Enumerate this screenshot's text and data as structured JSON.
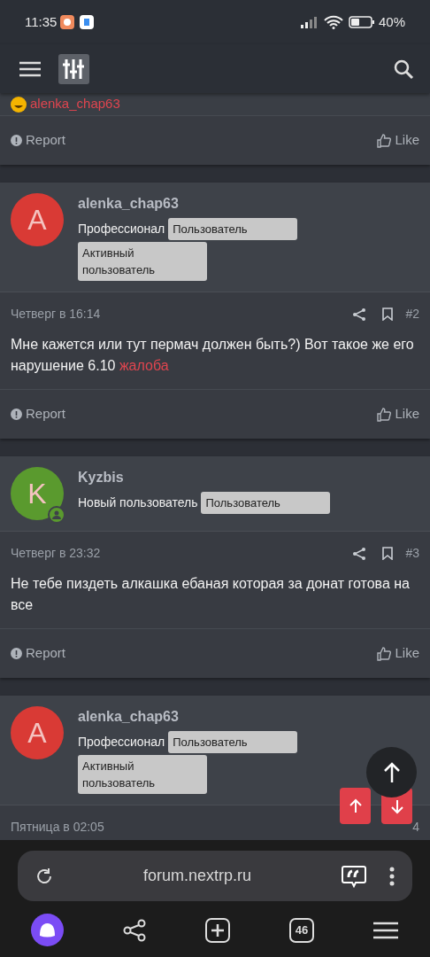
{
  "status_bar": {
    "time": "11:35",
    "battery": "40%"
  },
  "partial_post": {
    "reaction_user": "alenka_chap63",
    "report": "Report",
    "like": "Like"
  },
  "posts": [
    {
      "author": "alenka_chap63",
      "avatar_letter": "A",
      "color": "#d93a35",
      "online": false,
      "title": "Профессионал",
      "badges": [
        "Пользователь",
        "Активный пользователь"
      ],
      "date": "Четверг в 16:14",
      "actions_visible": true,
      "number": "#2",
      "message": "Мне кажется или тут пермач должен быть?) Вот такое же его нарушение 6.10",
      "link": "жалоба",
      "report": "Report",
      "like": "Like"
    },
    {
      "author": "Kyzbis",
      "avatar_letter": "K",
      "color": "#5a9a2e",
      "online": true,
      "title": "Новый пользователь",
      "badges": [
        "Пользователь"
      ],
      "date": "Четверг в 23:32",
      "actions_visible": true,
      "number": "#3",
      "message": "Не тебе пиздеть алкашка ебаная которая за донат готова на все",
      "report": "Report",
      "like": "Like"
    },
    {
      "author": "alenka_chap63",
      "avatar_letter": "A",
      "color": "#d93a35",
      "online": false,
      "title": "Профессионал",
      "badges": [
        "Пользователь",
        "Активный пользователь"
      ],
      "date": "Пятница в 02:05",
      "actions_visible": false,
      "number": "4"
    }
  ],
  "browser": {
    "url": "forum.nextrp.ru",
    "tabs_count": "46"
  }
}
